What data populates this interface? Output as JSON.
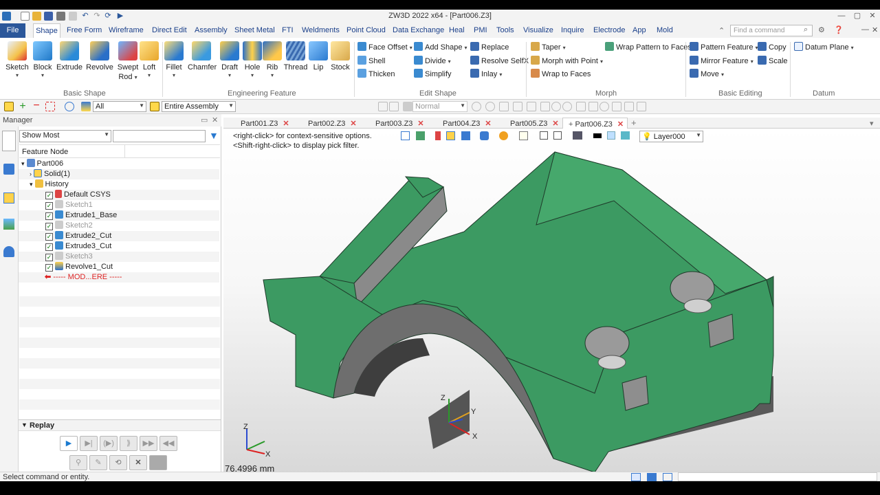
{
  "app": {
    "title": "ZW3D 2022 x64 - [Part006.Z3]"
  },
  "menu": {
    "file": "File",
    "shape": "Shape",
    "items": [
      "Free Form",
      "Wireframe",
      "Direct Edit",
      "Assembly",
      "Sheet Metal",
      "FTI",
      "Weldments",
      "Point Cloud",
      "Data Exchange",
      "Heal",
      "PMI",
      "Tools",
      "Visualize",
      "Inquire",
      "Electrode",
      "App",
      "Mold"
    ],
    "find_placeholder": "Find a command"
  },
  "ribbon": {
    "basic_shape": {
      "group": "Basic Shape",
      "items": [
        "Sketch",
        "Block",
        "Extrude",
        "Revolve",
        "Swept",
        "Loft"
      ],
      "swept_line2": "Rod"
    },
    "engineering": {
      "group": "Engineering Feature",
      "items": [
        "Fillet",
        "Chamfer",
        "Draft",
        "Hole",
        "Rib",
        "Thread",
        "Lip",
        "Stock"
      ]
    },
    "edit_shape": {
      "group": "Edit Shape",
      "items": [
        "Face Offset",
        "Add Shape",
        "Replace",
        "Shell",
        "Divide",
        "Resolve SelfX",
        "Thicken",
        "Simplify",
        "Inlay"
      ]
    },
    "morph": {
      "group": "Morph",
      "items": [
        "Taper",
        "Wrap Pattern to Faces",
        "Morph with Point",
        "Wrap to Faces"
      ]
    },
    "basic_editing": {
      "group": "Basic Editing",
      "items": [
        "Pattern Feature",
        "Copy",
        "Mirror Feature",
        "Scale",
        "Move"
      ]
    },
    "datum": {
      "group": "Datum",
      "items": [
        "Datum Plane"
      ]
    }
  },
  "toolbar": {
    "filter": "All",
    "scope": "Entire Assembly",
    "render": "Normal"
  },
  "manager": {
    "title": "Manager",
    "show": "Show Most",
    "column": "Feature Node",
    "tree": [
      {
        "label": "Part006"
      },
      {
        "label": "Solid(1)"
      },
      {
        "label": "History"
      },
      {
        "label": "Default CSYS"
      },
      {
        "label": "Sketch1"
      },
      {
        "label": "Extrude1_Base"
      },
      {
        "label": "Sketch2"
      },
      {
        "label": "Extrude2_Cut"
      },
      {
        "label": "Extrude3_Cut"
      },
      {
        "label": "Sketch3"
      },
      {
        "label": "Revolve1_Cut"
      },
      {
        "label": "----- MOD...ERE -----"
      }
    ],
    "replay": "Replay"
  },
  "tabs": [
    "Part001.Z3",
    "Part002.Z3",
    "Part003.Z3",
    "Part004.Z3",
    "Part005.Z3",
    "Part006.Z3"
  ],
  "viewport": {
    "hint1": "<right-click> for context-sensitive options.",
    "hint2": "<Shift-right-click> to display pick filter.",
    "layer": "Layer000",
    "distance": "76.4996 mm",
    "axes": {
      "x": "X",
      "y": "Y",
      "z": "Z"
    }
  },
  "status": {
    "text": "Select command or entity."
  },
  "colors": {
    "part": "#3c9a62",
    "accent": "#2b579a"
  }
}
